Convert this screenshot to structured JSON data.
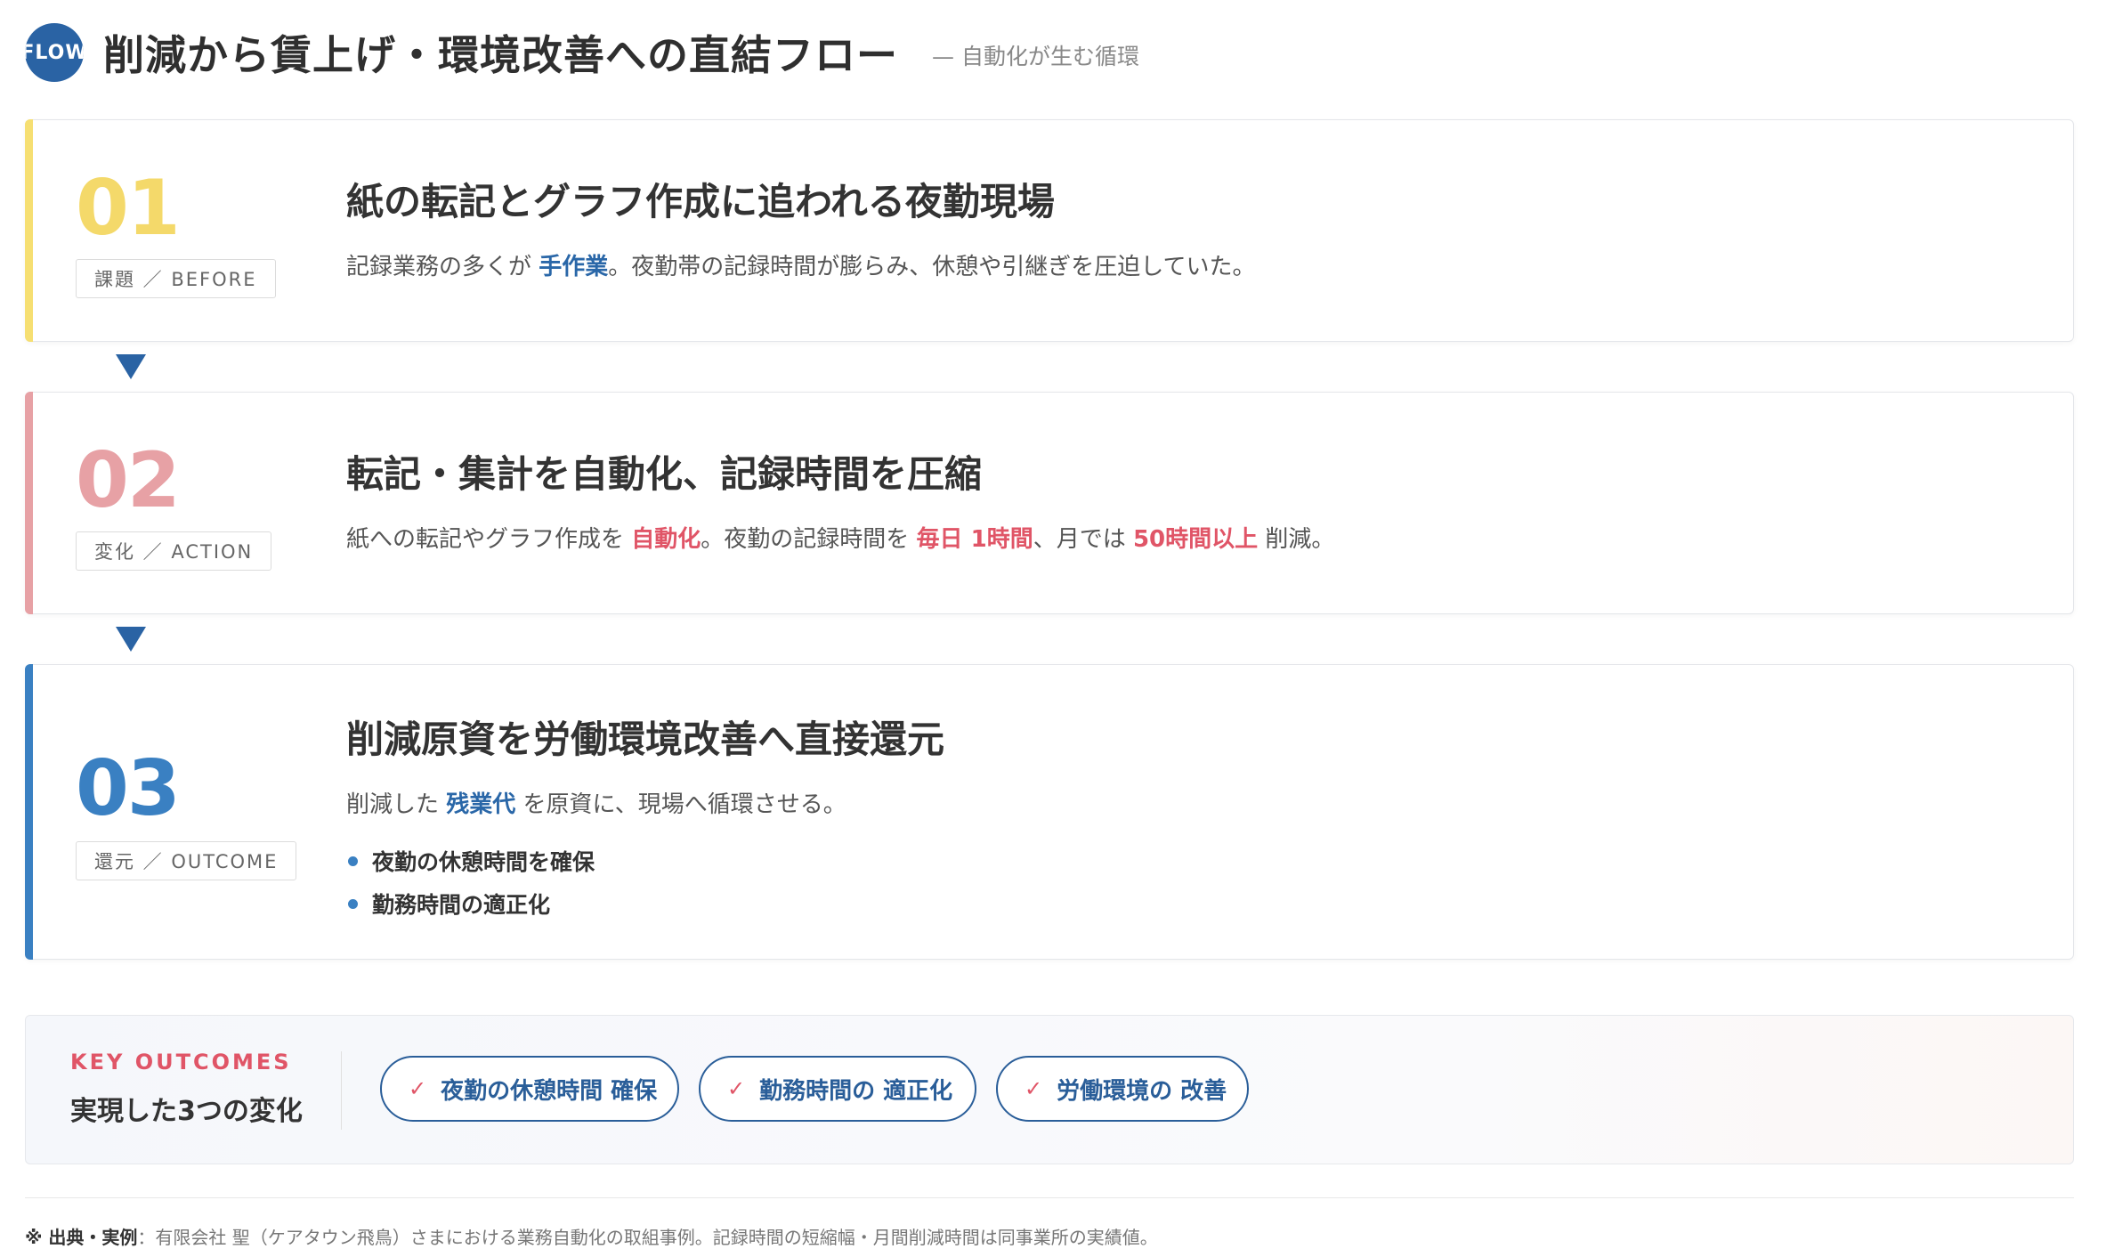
{
  "header": {
    "logo_text": "FLOW",
    "title": "削減から賃上げ・環境改善への直結フロー",
    "subtitle": "— 自動化が生む循環"
  },
  "steps": [
    {
      "number": "01",
      "tag": "課題 ／ BEFORE",
      "title": "紙の転記とグラフ作成に追われる夜勤現場",
      "body": {
        "pre": "記録業務の多くが ",
        "hl1": "手作業",
        "post": "。夜勤帯の記録時間が膨らみ、休憩や引継ぎを圧迫していた。"
      }
    },
    {
      "number": "02",
      "tag": "変化 ／ ACTION",
      "title": "転記・集計を自動化、記録時間を圧縮",
      "body": {
        "pre": "紙への転記やグラフ作成を ",
        "hl1": "自動化",
        "mid1": "。夜勤の記録時間を ",
        "hl2": "毎日 1時間",
        "mid2": "、月では ",
        "hl3": "50時間以上",
        "post": " 削減。"
      }
    },
    {
      "number": "03",
      "tag": "還元 ／ OUTCOME",
      "title": "削減原資を労働環境改善へ直接還元",
      "body": {
        "pre": "削減した ",
        "hl1": "残業代",
        "post": " を原資に、現場へ循環させる。"
      },
      "bullets": [
        "夜勤の休憩時間を確保",
        "勤務時間の適正化"
      ]
    }
  ],
  "outcomes": {
    "label": "KEY OUTCOMES",
    "title": "実現した3つの変化",
    "check": "✓",
    "pills": [
      "夜勤の休憩時間 確保",
      "勤務時間の 適正化",
      "労働環境の 改善"
    ]
  },
  "footnote": {
    "label": "※ 出典・実例",
    "text": "：有限会社 聖（ケアタウン飛鳥）さまにおける業務自動化の取組事例。記録時間の短縮幅・月間削減時間は同事業所の実績値。"
  },
  "colors": {
    "accent_blue": "#2a63a4",
    "step1": "#f4d96a",
    "step2": "#e7a1a5",
    "step3": "#3a80c2",
    "highlight_red": "#e05567"
  }
}
